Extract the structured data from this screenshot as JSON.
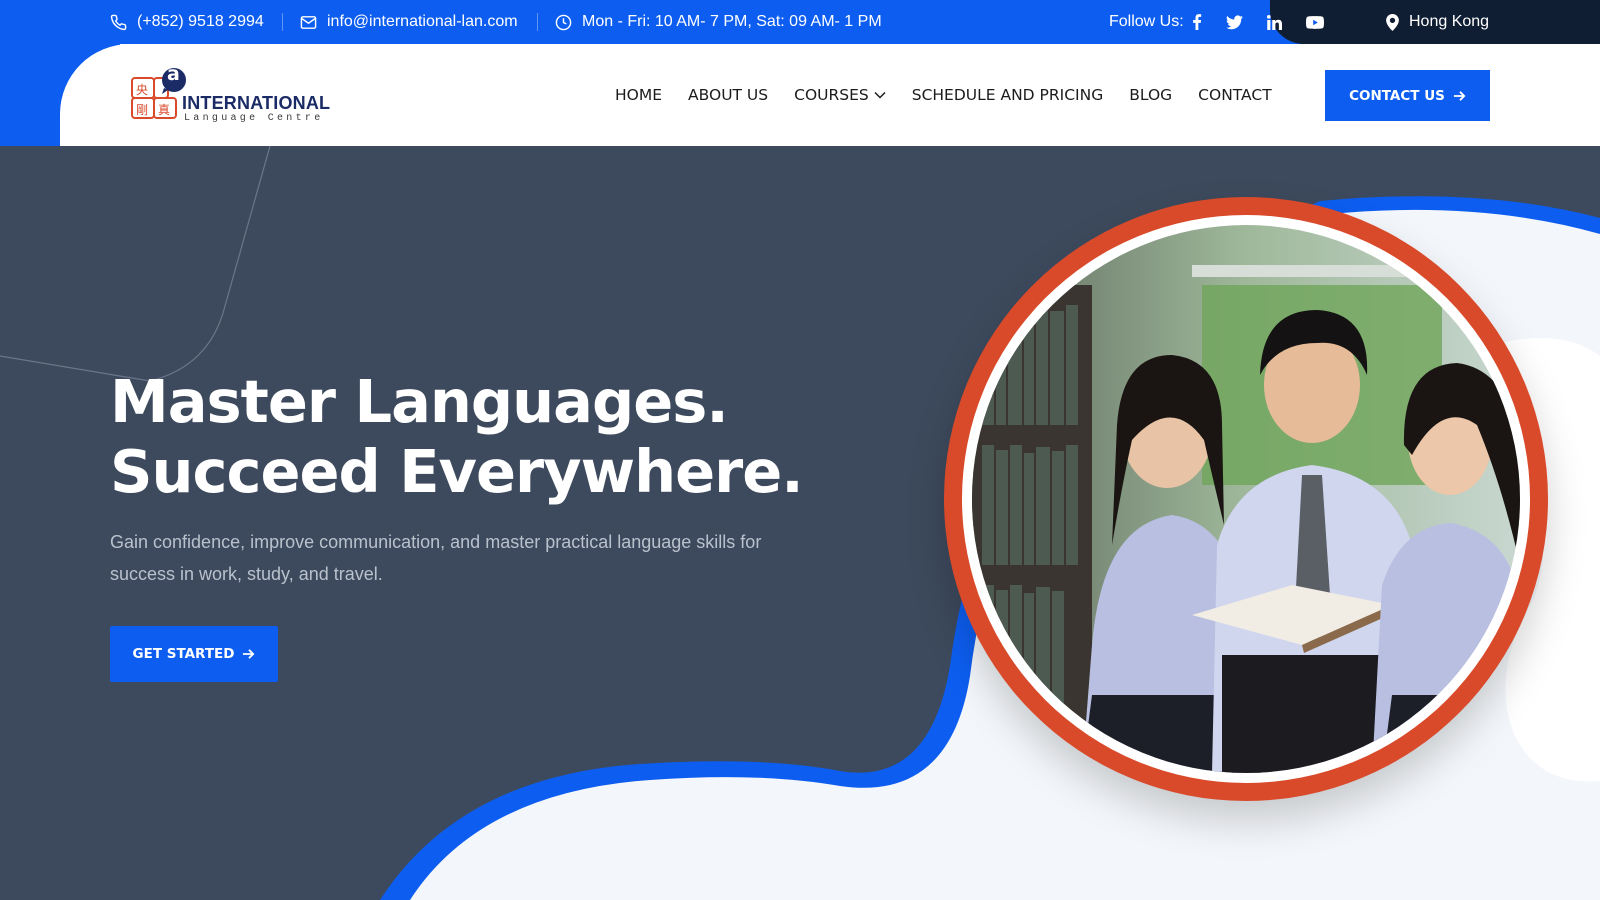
{
  "topbar": {
    "phone": "(+852) 9518 2994",
    "email": "info@international-lan.com",
    "hours": "Mon - Fri: 10 AM- 7 PM, Sat: 09 AM- 1 PM",
    "follow_label": "Follow Us:",
    "social_icons": [
      "facebook-icon",
      "twitter-icon",
      "linkedin-icon",
      "youtube-icon"
    ],
    "location": "Hong Kong"
  },
  "logo": {
    "name": "INTERNATIONAL",
    "tagline": "Language Centre",
    "badge_letter": "a"
  },
  "nav": {
    "items": [
      "HOME",
      "ABOUT US",
      "COURSES",
      "SCHEDULE AND PRICING",
      "BLOG",
      "CONTACT"
    ],
    "cta_label": "CONTACT US"
  },
  "hero": {
    "title_line1": "Master Languages.",
    "title_line2": "Succeed Everywhere.",
    "subtitle": "Gain confidence, improve communication, and master practical language skills for success in work, study, and travel.",
    "button_label": "GET STARTED"
  },
  "colors": {
    "primary_blue": "#0d5ef0",
    "dark_navy": "#0f1e33",
    "hero_bg": "#3d4a5d",
    "accent_red": "#d94a2b"
  }
}
